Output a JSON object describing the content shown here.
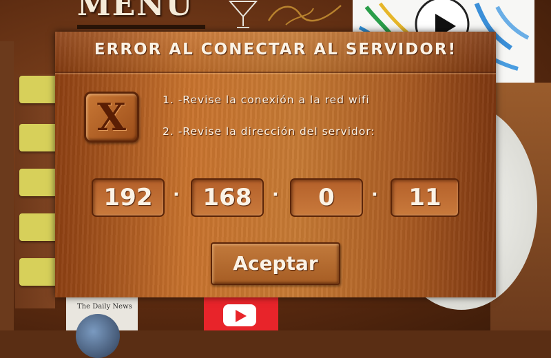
{
  "background": {
    "menu_title": "MENU",
    "news_title": "The Daily News"
  },
  "dialog": {
    "title": "ERROR AL CONECTAR AL SERVIDOR!",
    "icon": "error-x-icon",
    "instruction_1": "1. -Revise la conexión a la red wifi",
    "instruction_2": "2. -Revise la dirección del servidor:",
    "ip": {
      "octet_1": "192",
      "octet_2": "168",
      "octet_3": "0",
      "octet_4": "11",
      "separator": "·"
    },
    "accept_label": "Aceptar"
  },
  "colors": {
    "wood_dark": "#7c3610",
    "wood_light": "#c67a34",
    "text": "#fbf3e6",
    "border": "#5b2509"
  }
}
